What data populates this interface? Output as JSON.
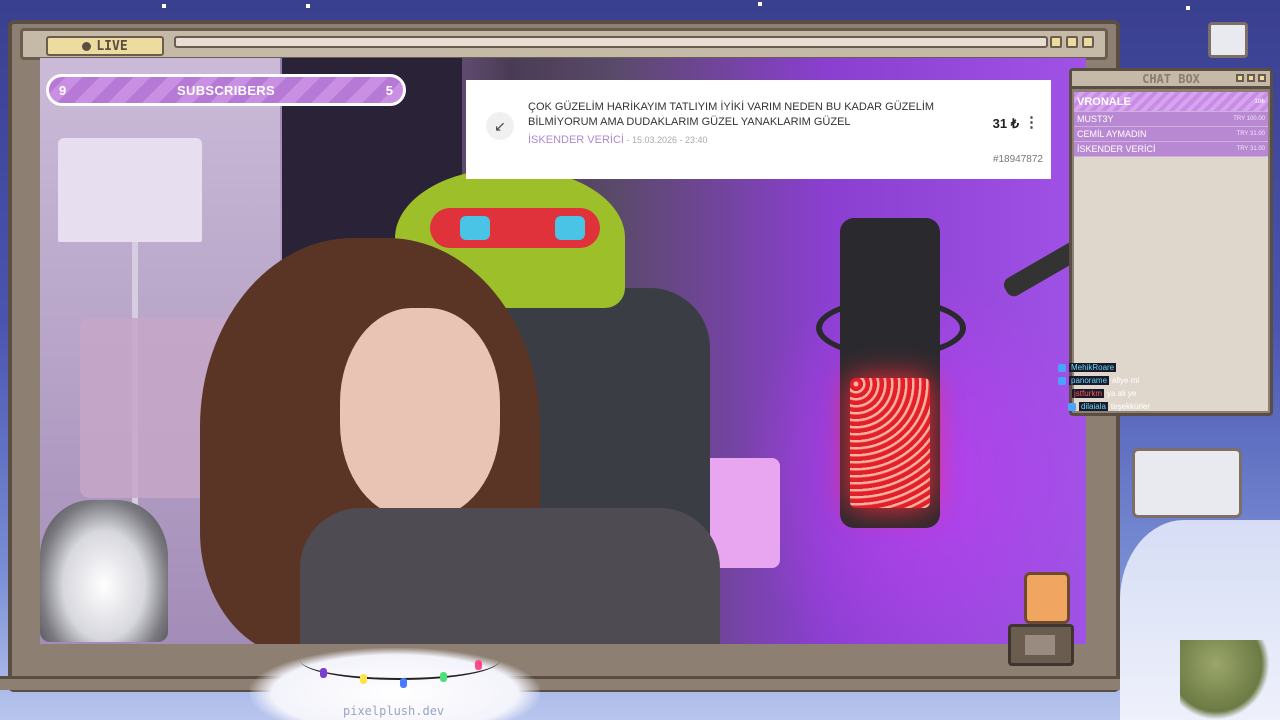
{
  "stream": {
    "live_label": "LIVE",
    "watermark": "pixelplush.dev"
  },
  "subscribers": {
    "left_count": "9",
    "label": "SUBSCRIBERS",
    "right_count": "5",
    "progress_fraction": 0.55
  },
  "donation_alert": {
    "arrow_icon": "arrow-down-left-icon",
    "message": "ÇOK GÜZELİM HARİKAYIM TATLIYIM İYİKİ VARIM NEDEN BU KADAR GÜZELİM BİLMİYORUM AMA DUDAKLARIM GÜZEL YANAKLARIM GÜZEL",
    "sender": "İSKENDER VERİCİ",
    "separator": " - ",
    "datetime": "15.03.2026 - 23:40",
    "amount": "31 ₺",
    "id": "#18947872"
  },
  "chat_box": {
    "title": "CHAT BOX",
    "donations": [
      {
        "name": "VRONALE",
        "amount": "10₺"
      },
      {
        "name": "MUST3Y",
        "amount": "TRY 100.00"
      },
      {
        "name": "CEMİL AYMADIN",
        "amount": "TRY 31.00"
      },
      {
        "name": "İSKENDER VERİCİ",
        "amount": "TRY 31.00"
      }
    ],
    "messages": [
      {
        "user": "MehikRoare",
        "text": ""
      },
      {
        "user": "panorame",
        "text": "aliye mi"
      },
      {
        "user": "jstfurkm",
        "text": "ya ali ye"
      },
      {
        "user": "dilaiala",
        "text": "teşekkürler"
      }
    ]
  },
  "colors": {
    "frame": "#8d7f72",
    "frame_border": "#5a4d43",
    "accent_purple": "#b779d6",
    "mic_glow": "#e2202a"
  }
}
